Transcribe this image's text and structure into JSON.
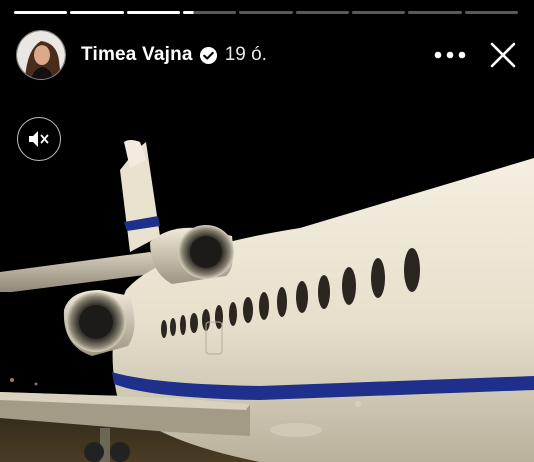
{
  "story": {
    "user_name": "Timea Vajna",
    "timestamp": "19 ó.",
    "progress_segments": 9,
    "completed_segments": 3,
    "active_segment_fraction": 0.2
  },
  "icons": {
    "verified": "verified-badge-icon",
    "more": "more-options-icon",
    "close": "close-icon",
    "mute": "speaker-muted-icon"
  },
  "colors": {
    "background": "#000000",
    "fuselage": "#e9e3d2",
    "cheatline": "#1f2f8c"
  }
}
